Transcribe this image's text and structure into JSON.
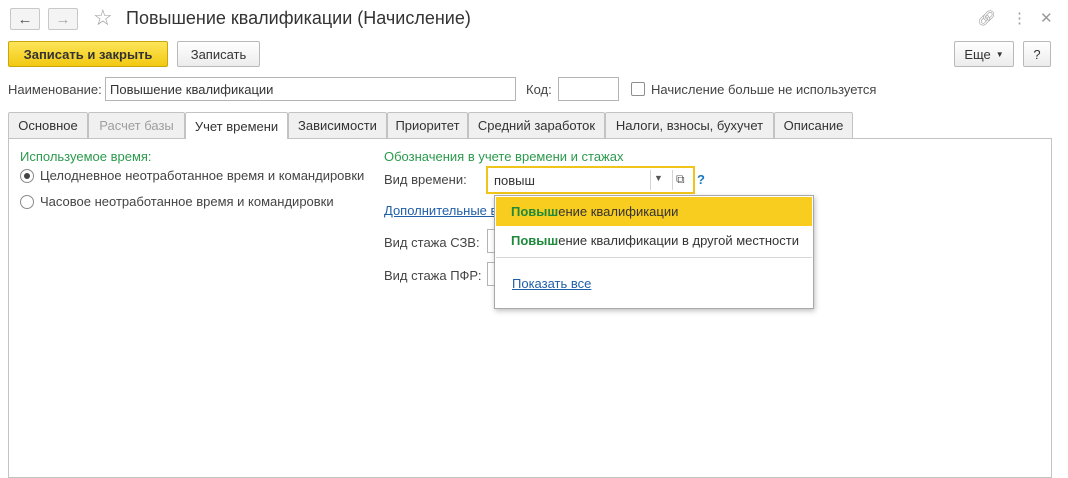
{
  "window": {
    "title": "Повышение квалификации (Начисление)"
  },
  "toolbar": {
    "save_close_label": "Записать и закрыть",
    "save_label": "Записать",
    "more_label": "Еще",
    "help_label": "?"
  },
  "form": {
    "name_label": "Наименование:",
    "name_value": "Повышение квалификации",
    "code_label": "Код:",
    "code_value": "",
    "unused_label": "Начисление больше не используется"
  },
  "tabs": [
    {
      "label": "Основное",
      "state": "normal"
    },
    {
      "label": "Расчет базы",
      "state": "disabled"
    },
    {
      "label": "Учет времени",
      "state": "active"
    },
    {
      "label": "Зависимости",
      "state": "normal"
    },
    {
      "label": "Приоритет",
      "state": "normal"
    },
    {
      "label": "Средний заработок",
      "state": "normal"
    },
    {
      "label": "Налоги, взносы, бухучет",
      "state": "normal"
    },
    {
      "label": "Описание",
      "state": "normal"
    }
  ],
  "time_tab": {
    "used_time_title": "Используемое время:",
    "radio_options": [
      {
        "label": "Целодневное неотработанное время и командировки",
        "checked": true
      },
      {
        "label": "Часовое неотработанное время и командировки",
        "checked": false
      }
    ],
    "notation_title": "Обозначения в учете времени и стажах",
    "time_type_label": "Вид времени:",
    "time_type_value": "повыш",
    "help_mark": "?",
    "additional_link": "Дополнительные в",
    "szv_label": "Вид стажа СЗВ:",
    "pfr_label": "Вид стажа ПФР:"
  },
  "dropdown": {
    "items": [
      {
        "match": "Повыш",
        "rest": "ение квалификации",
        "selected": true
      },
      {
        "match": "Повыш",
        "rest": "ение квалификации в другой местности",
        "selected": false
      }
    ],
    "show_all": "Показать все"
  },
  "colors": {
    "accent_yellow": "#f2c911",
    "group_green": "#2b9a4d",
    "match_green": "#1f8a3c",
    "link_blue": "#1f5fa8"
  }
}
